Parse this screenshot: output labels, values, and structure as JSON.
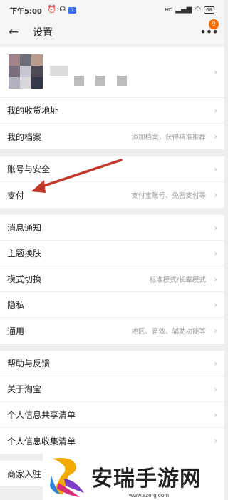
{
  "status_bar": {
    "time": "下午5:00",
    "left_icons": [
      "alarm-icon",
      "headset-icon",
      "app-icon"
    ],
    "app_badge_text": "7",
    "signal": "HD",
    "battery": "68"
  },
  "header": {
    "back_icon": "back-arrow-icon",
    "title": "设置",
    "more_icon": "more-dots-icon",
    "badge": "9"
  },
  "profile": {
    "avatar_colors": [
      "#a0848a",
      "#6f6f7a",
      "#b99c8c",
      "#7a6f7c",
      "#c9c6d2",
      "#4e4a54",
      "#b2b0bc",
      "#d9d6dc",
      "#35384a"
    ]
  },
  "groups": [
    {
      "items": [
        {
          "label": "我的收货地址",
          "hint": ""
        },
        {
          "label": "我的档案",
          "hint": "添加档案，获得精准推荐"
        }
      ]
    },
    {
      "items": [
        {
          "label": "账号与安全",
          "hint": ""
        },
        {
          "label": "支付",
          "hint": "支付宝账号、免密支付等"
        }
      ]
    },
    {
      "items": [
        {
          "label": "消息通知",
          "hint": ""
        },
        {
          "label": "主题换肤",
          "hint": ""
        },
        {
          "label": "模式切换",
          "hint": "标准模式/长辈模式"
        },
        {
          "label": "隐私",
          "hint": ""
        },
        {
          "label": "通用",
          "hint": "地区、音效、辅助功能等"
        }
      ]
    },
    {
      "items": [
        {
          "label": "帮助与反馈",
          "hint": ""
        },
        {
          "label": "关于淘宝",
          "hint": ""
        },
        {
          "label": "个人信息共享清单",
          "hint": ""
        },
        {
          "label": "个人信息收集清单",
          "hint": ""
        }
      ]
    },
    {
      "items": [
        {
          "label": "商家入驻",
          "hint": ""
        }
      ]
    }
  ],
  "annotation": {
    "color": "#c0392b"
  },
  "watermark": {
    "text": "安瑞手游网",
    "url": "www.szerg.com",
    "logo_colors": [
      "#f2a900",
      "#7a3fc6",
      "#d62f7a",
      "#2b86d9"
    ]
  }
}
